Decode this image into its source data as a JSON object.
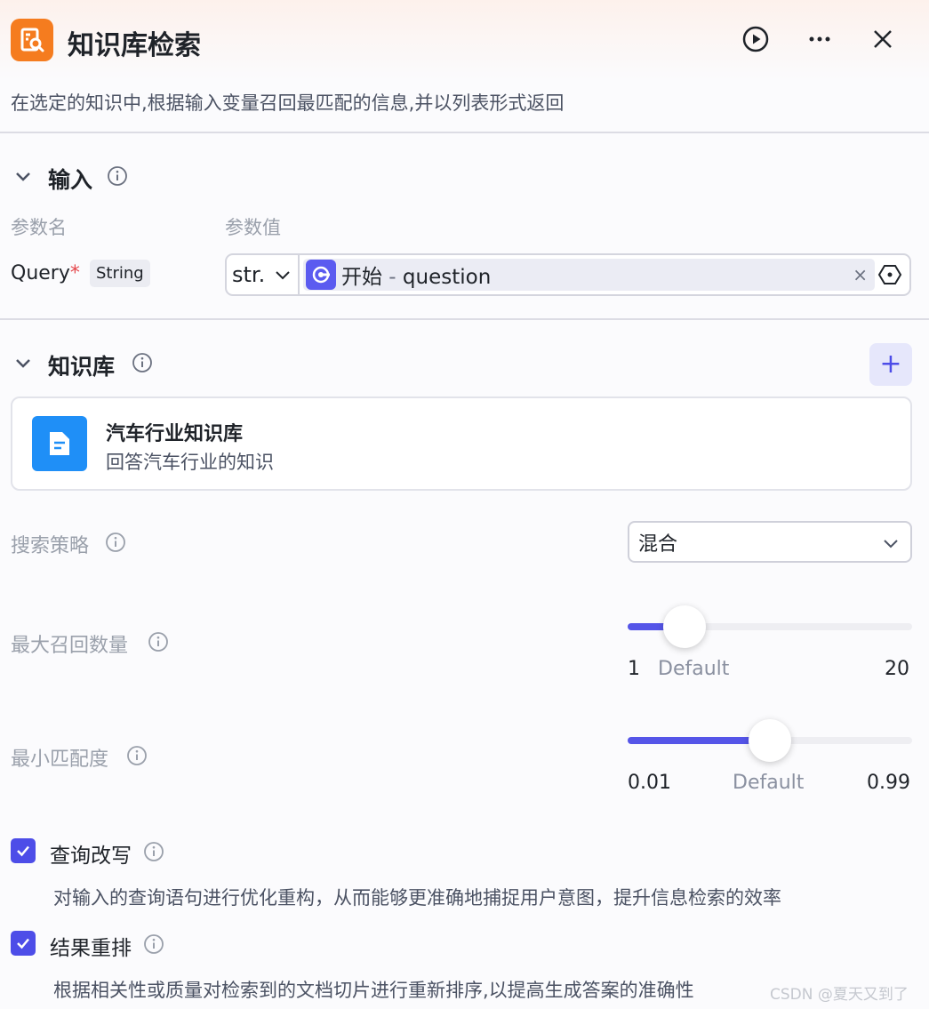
{
  "header": {
    "title": "知识库检索",
    "description": "在选定的知识中,根据输入变量召回最匹配的信息,并以列表形式返回"
  },
  "input_section": {
    "title": "输入",
    "col_name": "参数名",
    "col_value": "参数值",
    "param": {
      "name": "Query",
      "required_mark": "*",
      "type": "String",
      "value_type": "str.",
      "var_source": "开始",
      "var_sep": " - ",
      "var_name": "question",
      "clear_glyph": "×"
    }
  },
  "kb_section": {
    "title": "知识库",
    "add_glyph": "+",
    "items": [
      {
        "name": "汽车行业知识库",
        "description": "回答汽车行业的知识"
      }
    ]
  },
  "search_strategy": {
    "label": "搜索策略",
    "value": "混合"
  },
  "max_recall": {
    "label": "最大召回数量",
    "min": "1",
    "max": "20",
    "default_label": "Default",
    "level": 0.2
  },
  "min_match": {
    "label": "最小匹配度",
    "min": "0.01",
    "max": "0.99",
    "default_label": "Default",
    "level": 0.5
  },
  "options": [
    {
      "label": "查询改写",
      "checked": true,
      "description": "对输入的查询语句进行优化重构，从而能够更准确地捕捉用户意图，提升信息检索的效率"
    },
    {
      "label": "结果重排",
      "checked": true,
      "description": "根据相关性或质量对检索到的文档切片进行重新排序,以提高生成答案的准确性"
    }
  ],
  "watermark": "CSDN @夏天又到了",
  "colors": {
    "accent": "#5555e8",
    "app_icon": "#f57c1f",
    "kb_icon": "#1f8ff7"
  }
}
